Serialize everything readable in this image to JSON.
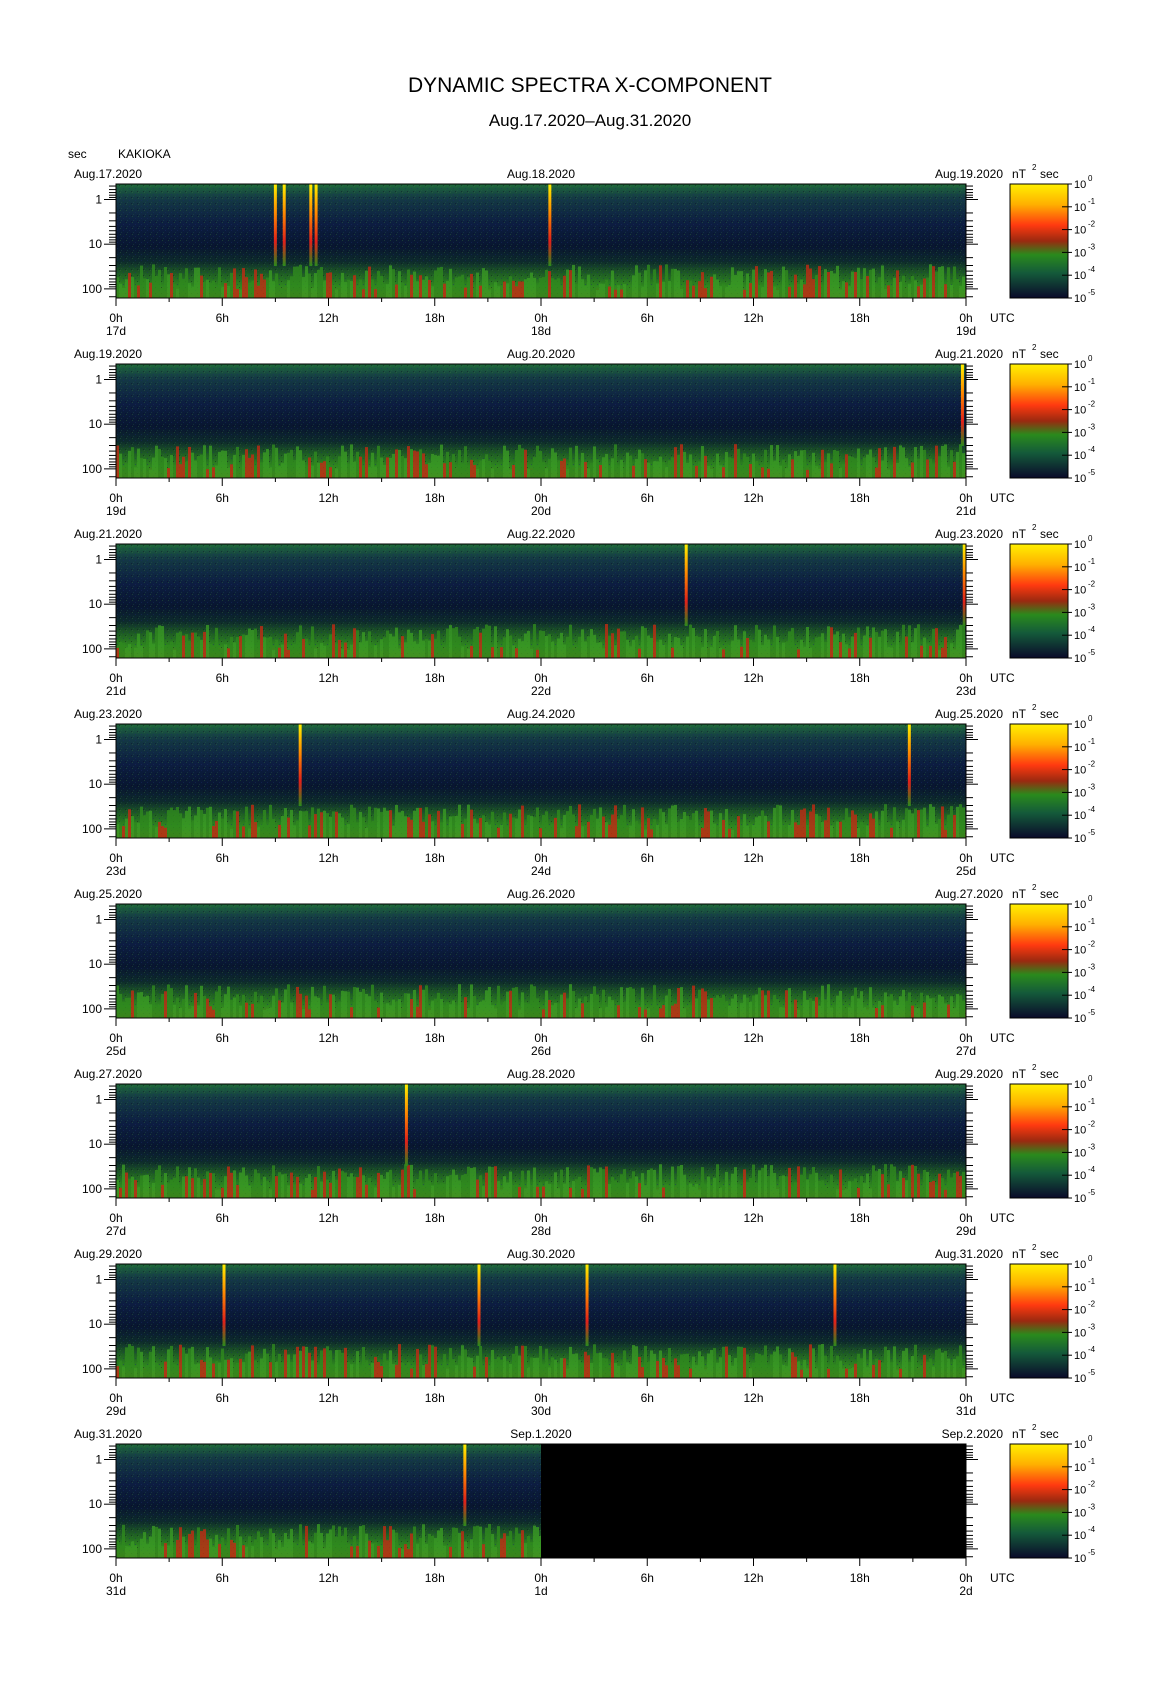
{
  "title": "DYNAMIC SPECTRA X-COMPONENT",
  "subtitle": "Aug.17.2020–Aug.31.2020",
  "y_unit": "sec",
  "station": "KAKIOKA",
  "tz_label": "UTC",
  "colorbar_unit_base": "nT",
  "colorbar_unit_exp": "2",
  "colorbar_unit_suffix": "sec",
  "colorbar_exponents": [
    "0",
    "-1",
    "-2",
    "-3",
    "-4",
    "-5"
  ],
  "colorbar_base": "10",
  "colors": {
    "background": "#000000",
    "low": "#0b1a3a",
    "mid": "#2a8a1c",
    "high": "#e0201a",
    "max": "#ffe800"
  },
  "chart_data": {
    "type": "heatmap",
    "x_axis": "UTC hours (2 days per panel)",
    "y_axis": "period [sec], log scale, inverted",
    "y_ticks": [
      "1",
      "10",
      "100"
    ],
    "x_tick_labels": [
      "0h",
      "6h",
      "12h",
      "18h",
      "0h",
      "6h",
      "12h",
      "18h",
      "0h"
    ],
    "panels": [
      {
        "left_date": "Aug.17.2020",
        "mid_date": "Aug.18.2020",
        "right_date": "Aug.19.2020",
        "day_labels": [
          "17d",
          "18d",
          "19d"
        ],
        "spikes_h": [
          9.0,
          9.5,
          11.0,
          11.3,
          24.5
        ],
        "data_end_h": 48
      },
      {
        "left_date": "Aug.19.2020",
        "mid_date": "Aug.20.2020",
        "right_date": "Aug.21.2020",
        "day_labels": [
          "19d",
          "20d",
          "21d"
        ],
        "spikes_h": [
          47.8
        ],
        "data_end_h": 48
      },
      {
        "left_date": "Aug.21.2020",
        "mid_date": "Aug.22.2020",
        "right_date": "Aug.23.2020",
        "day_labels": [
          "21d",
          "22d",
          "23d"
        ],
        "spikes_h": [
          32.2,
          47.9
        ],
        "data_end_h": 48
      },
      {
        "left_date": "Aug.23.2020",
        "mid_date": "Aug.24.2020",
        "right_date": "Aug.25.2020",
        "day_labels": [
          "23d",
          "24d",
          "25d"
        ],
        "spikes_h": [
          10.4,
          44.8
        ],
        "data_end_h": 48
      },
      {
        "left_date": "Aug.25.2020",
        "mid_date": "Aug.26.2020",
        "right_date": "Aug.27.2020",
        "day_labels": [
          "25d",
          "26d",
          "27d"
        ],
        "spikes_h": [],
        "data_end_h": 48
      },
      {
        "left_date": "Aug.27.2020",
        "mid_date": "Aug.28.2020",
        "right_date": "Aug.29.2020",
        "day_labels": [
          "27d",
          "28d",
          "29d"
        ],
        "spikes_h": [
          16.4
        ],
        "data_end_h": 48
      },
      {
        "left_date": "Aug.29.2020",
        "mid_date": "Aug.30.2020",
        "right_date": "Aug.31.2020",
        "day_labels": [
          "29d",
          "30d",
          "31d"
        ],
        "spikes_h": [
          6.1,
          20.5,
          26.6,
          40.6
        ],
        "data_end_h": 48
      },
      {
        "left_date": "Aug.31.2020",
        "mid_date": "Sep.1.2020",
        "right_date": "Sep.2.2020",
        "day_labels": [
          "31d",
          "1d",
          "2d"
        ],
        "spikes_h": [
          19.7
        ],
        "data_end_h": 24
      }
    ]
  }
}
